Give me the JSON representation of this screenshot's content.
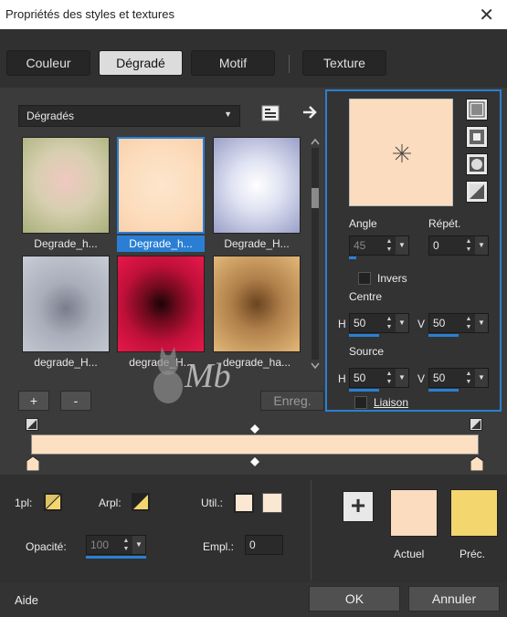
{
  "window": {
    "title": "Propriétés des styles et textures",
    "close": "✕"
  },
  "tabs": [
    {
      "label": "Couleur"
    },
    {
      "label": "Dégradé"
    },
    {
      "label": "Motif"
    },
    {
      "label": "Texture"
    }
  ],
  "gradient_set": {
    "value": "Dégradés"
  },
  "thumbnails": [
    {
      "label": "Degrade_h..."
    },
    {
      "label": "Degrade_h..."
    },
    {
      "label": "Degrade_H..."
    },
    {
      "label": "degrade_H..."
    },
    {
      "label": "degrade_H..."
    },
    {
      "label": "degrade_ha..."
    }
  ],
  "list_buttons": {
    "add": "+",
    "remove": "-",
    "save": "Enreg."
  },
  "watermark": "Mb",
  "props": {
    "angle_label": "Angle",
    "repeat_label": "Répét.",
    "angle": "45",
    "repeat": "0",
    "invert_label": "Invers",
    "center_label": "Centre",
    "h_label": "H",
    "v_label": "V",
    "center_h": "50",
    "center_v": "50",
    "source_label": "Source",
    "source_h": "50",
    "source_v": "50",
    "link_label": "Liaison"
  },
  "colors": {
    "first_label": "1pl:",
    "arrange_label": "Arpl:",
    "use_label": "Util.:",
    "opacity_label": "Opacité:",
    "opacity": "100",
    "location_label": "Empl.:",
    "location": "0",
    "current_label": "Actuel",
    "previous_label": "Préc.",
    "current_color": "#fbdcbe",
    "previous_color": "#f3d66e",
    "gradient_color": "#fde0c2"
  },
  "footer": {
    "help": "Aide",
    "ok": "OK",
    "cancel": "Annuler"
  }
}
